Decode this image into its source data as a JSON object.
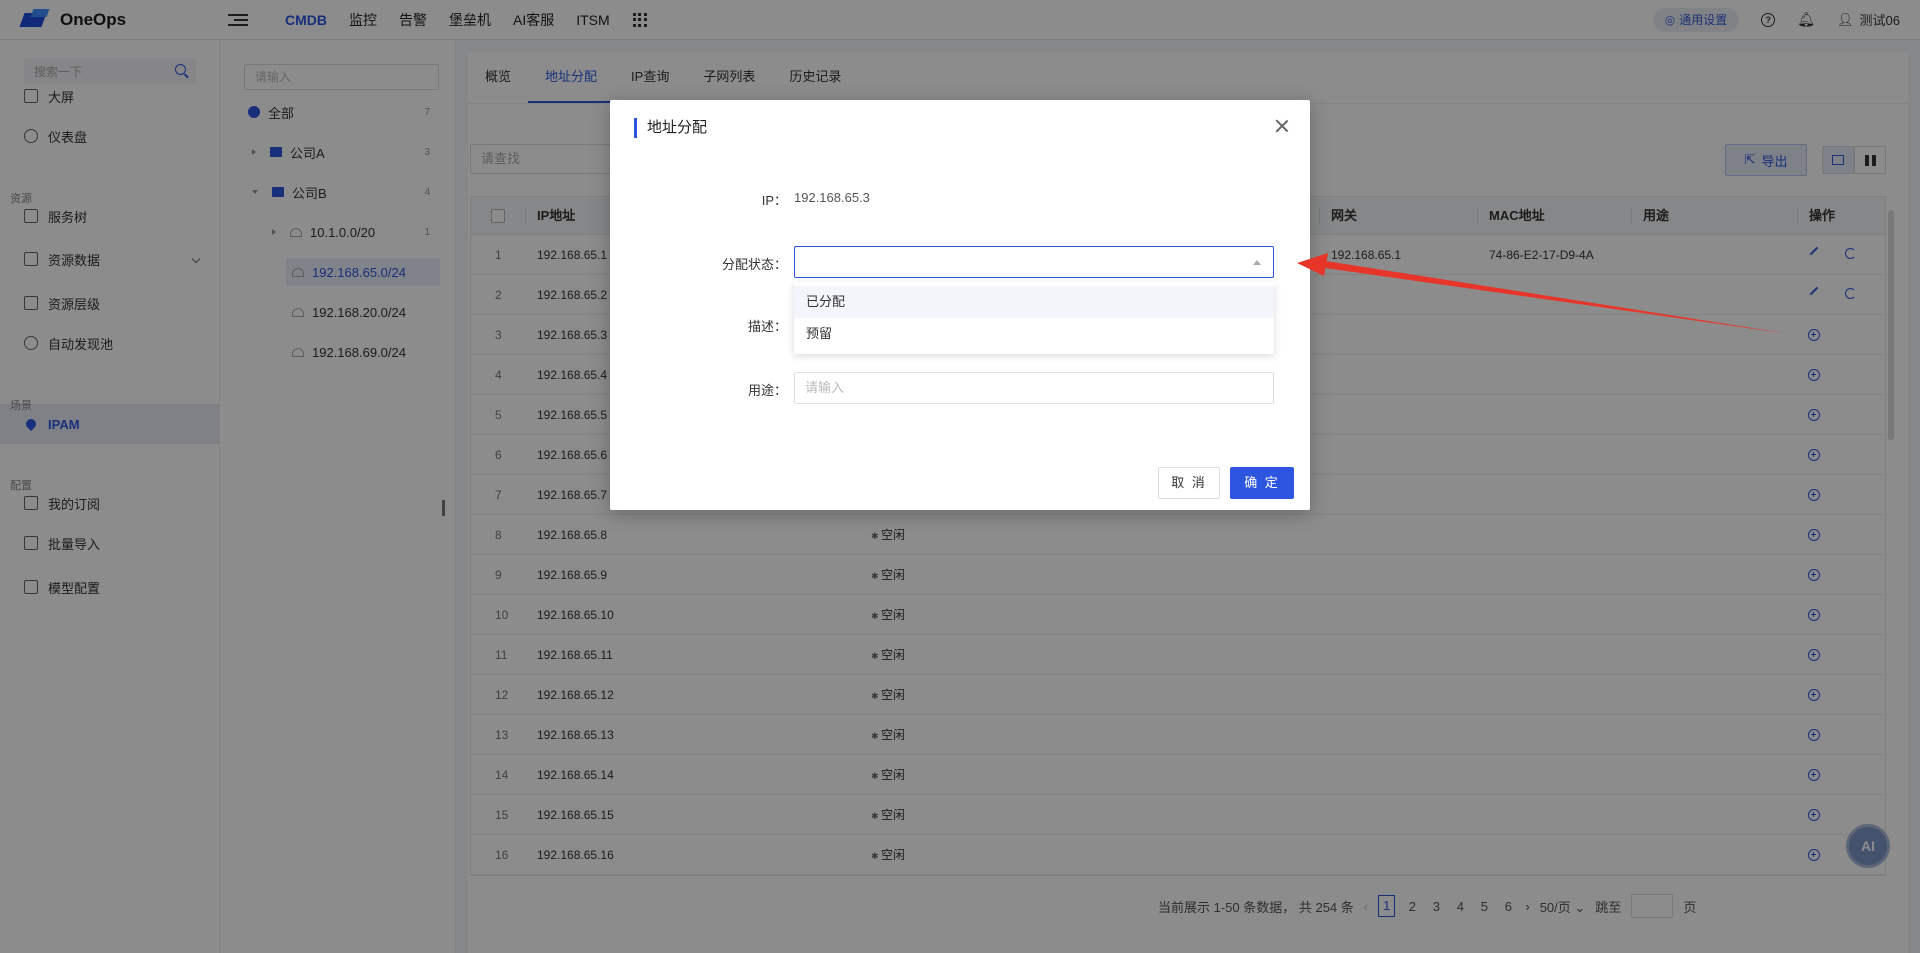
{
  "app": {
    "name": "OneOps"
  },
  "nav": {
    "items": [
      "CMDB",
      "监控",
      "告警",
      "堡垒机",
      "AI客服",
      "ITSM"
    ],
    "active_index": 0
  },
  "top_right": {
    "settings_label": "通用设置",
    "user_name": "测试06"
  },
  "sidebar": {
    "search_placeholder": "搜索一下",
    "items": [
      {
        "label": "大屏",
        "icon": "monitor-icon"
      },
      {
        "label": "仪表盘",
        "icon": "dashboard-icon"
      },
      {
        "label": "服务树",
        "icon": "tree-icon"
      },
      {
        "label": "资源数据",
        "icon": "database-icon"
      },
      {
        "label": "资源层级",
        "icon": "layers-icon"
      },
      {
        "label": "自动发现池",
        "icon": "discover-icon"
      },
      {
        "label": "IPAM",
        "icon": "location-icon"
      },
      {
        "label": "我的订阅",
        "icon": "bookmark-icon"
      },
      {
        "label": "批量导入",
        "icon": "import-icon"
      },
      {
        "label": "模型配置",
        "icon": "model-icon"
      }
    ],
    "groups": [
      "资源",
      "场景",
      "配置"
    ],
    "active_label": "IPAM"
  },
  "tree": {
    "search_placeholder": "请输入",
    "nodes": [
      {
        "label": "全部",
        "count": "7"
      },
      {
        "label": "公司A",
        "count": "3"
      },
      {
        "label": "公司B",
        "count": "4"
      },
      {
        "label": "10.1.0.0/20",
        "count": "1"
      },
      {
        "label": "192.168.65.0/24",
        "count": ""
      },
      {
        "label": "192.168.20.0/24",
        "count": ""
      },
      {
        "label": "192.168.69.0/24",
        "count": ""
      }
    ],
    "selected": "192.168.65.0/24"
  },
  "tabs": [
    "概览",
    "地址分配",
    "IP查询",
    "子网列表",
    "历史记录"
  ],
  "active_tab": "地址分配",
  "toolbar": {
    "search_placeholder": "请查找",
    "export_label": "导出"
  },
  "table": {
    "headers": {
      "ip": "IP地址",
      "gateway": "网关",
      "mac": "MAC地址",
      "usage": "用途",
      "ops": "操作"
    },
    "rows": [
      {
        "idx": "1",
        "ip": "192.168.65.1",
        "status": "",
        "gateway": "192.168.65.1",
        "mac": "74-86-E2-17-D9-4A",
        "edit": true
      },
      {
        "idx": "2",
        "ip": "192.168.65.2",
        "status": "",
        "gateway": "",
        "mac": "",
        "edit": true
      },
      {
        "idx": "3",
        "ip": "192.168.65.3",
        "status": "",
        "gateway": "",
        "mac": "",
        "edit": false
      },
      {
        "idx": "4",
        "ip": "192.168.65.4",
        "status": "",
        "gateway": "",
        "mac": "",
        "edit": false
      },
      {
        "idx": "5",
        "ip": "192.168.65.5",
        "status": "",
        "gateway": "",
        "mac": "",
        "edit": false
      },
      {
        "idx": "6",
        "ip": "192.168.65.6",
        "status": "",
        "gateway": "",
        "mac": "",
        "edit": false
      },
      {
        "idx": "7",
        "ip": "192.168.65.7",
        "status": "",
        "gateway": "",
        "mac": "",
        "edit": false
      },
      {
        "idx": "8",
        "ip": "192.168.65.8",
        "status": "空闲",
        "gateway": "",
        "mac": "",
        "edit": false
      },
      {
        "idx": "9",
        "ip": "192.168.65.9",
        "status": "空闲",
        "gateway": "",
        "mac": "",
        "edit": false
      },
      {
        "idx": "10",
        "ip": "192.168.65.10",
        "status": "空闲",
        "gateway": "",
        "mac": "",
        "edit": false
      },
      {
        "idx": "11",
        "ip": "192.168.65.11",
        "status": "空闲",
        "gateway": "",
        "mac": "",
        "edit": false
      },
      {
        "idx": "12",
        "ip": "192.168.65.12",
        "status": "空闲",
        "gateway": "",
        "mac": "",
        "edit": false
      },
      {
        "idx": "13",
        "ip": "192.168.65.13",
        "status": "空闲",
        "gateway": "",
        "mac": "",
        "edit": false
      },
      {
        "idx": "14",
        "ip": "192.168.65.14",
        "status": "空闲",
        "gateway": "",
        "mac": "",
        "edit": false
      },
      {
        "idx": "15",
        "ip": "192.168.65.15",
        "status": "空闲",
        "gateway": "",
        "mac": "",
        "edit": false
      },
      {
        "idx": "16",
        "ip": "192.168.65.16",
        "status": "空闲",
        "gateway": "",
        "mac": "",
        "edit": false
      }
    ]
  },
  "pagination": {
    "summary": "当前展示 1-50 条数据， 共 254 条",
    "pages": [
      "1",
      "2",
      "3",
      "4",
      "5",
      "6"
    ],
    "current": "1",
    "page_size": "50/页",
    "jump_label": "跳至",
    "page_unit": "页"
  },
  "modal": {
    "title": "地址分配",
    "ip_label": "IP：",
    "ip_value": "192.168.65.3",
    "status_label": "分配状态：",
    "status_options": [
      "已分配",
      "预留"
    ],
    "desc_label": "描述：",
    "usage_label": "用途：",
    "usage_placeholder": "请输入",
    "cancel_label": "取 消",
    "ok_label": "确 定"
  },
  "ai_badge": "AI",
  "colors": {
    "primary": "#2d56e0",
    "annotation_arrow": "#e8352a"
  }
}
